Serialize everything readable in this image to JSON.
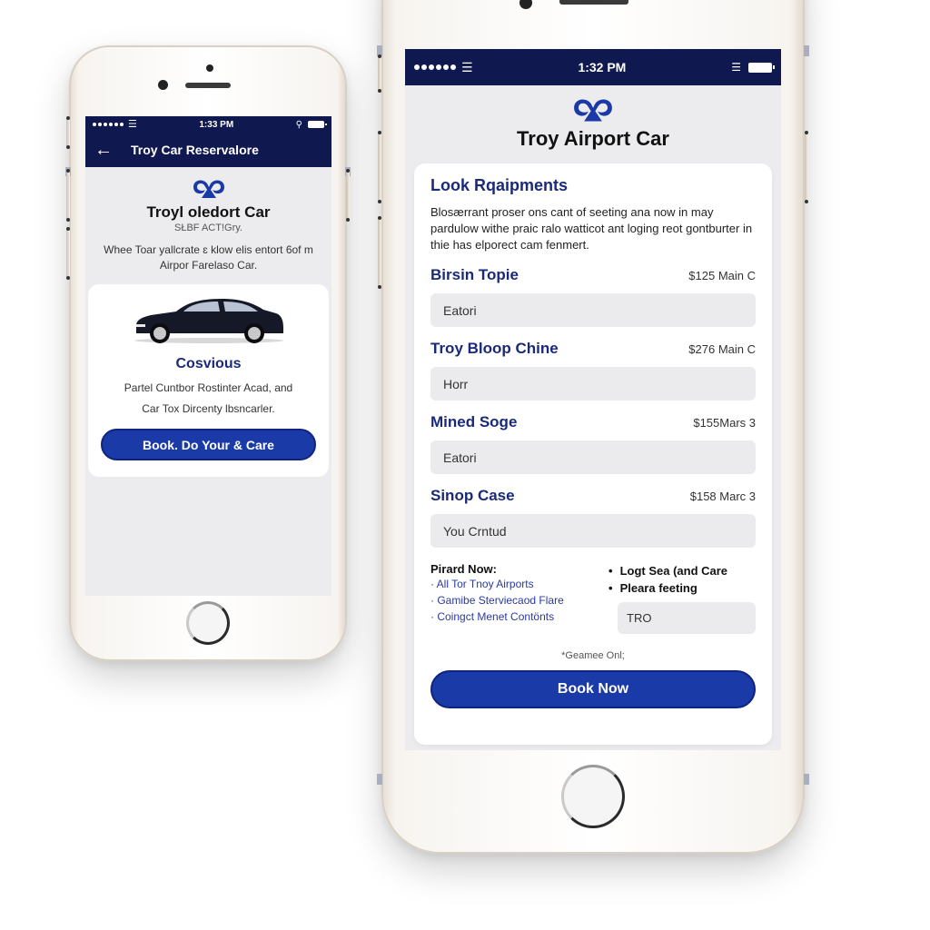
{
  "colors": {
    "navy": "#10194f",
    "brand_blue": "#1a3aa8",
    "heading_blue": "#1a2a7a",
    "screen_bg": "#ececee",
    "field_bg": "#ebebee"
  },
  "left_phone": {
    "status": {
      "time": "1:33 PM",
      "signal_icon": "signal-dots",
      "wifi_icon": "wifi-icon",
      "battery_icon": "battery-icon"
    },
    "navbar": {
      "back_icon": "←",
      "title": "Troy Car Reservalore"
    },
    "brand": {
      "logo_icon": "brand-logo",
      "title": "Troyl oledort Car",
      "subtitle": "SŁBF ACT!Gry.",
      "description": "Whee Toar yallcrate ɛ klow elis entort 6of m Airpor Farelaso Car."
    },
    "car_card": {
      "image": "black-sedan",
      "name": "Cosvious",
      "description_line1": "Partel Cuntbor Rostinter Acad, and",
      "description_line2": "Car Tox Dircenty lbsncarler.",
      "button_label": "Book. Do Your & Care"
    }
  },
  "right_phone": {
    "status": {
      "time": "1:32 PM",
      "signal_icon": "signal-dots",
      "wifi_icon": "wifi-icon",
      "battery_icon": "battery-icon"
    },
    "brand": {
      "logo_icon": "brand-logo",
      "title": "Troy Airport Car"
    },
    "card": {
      "heading": "Look Rqaipments",
      "intro": "Blosærrant proser ons cant of seeting ana now in may pardulow withe praic ralo watticot ant loging reot gontburter in thie has elporect cam fenmert.",
      "options": [
        {
          "name": "Birsin Topie",
          "price": "$125 Main C",
          "field_value": "Eatori"
        },
        {
          "name": "Troy Bloop Chine",
          "price": "$276 Main C",
          "field_value": "Horr"
        },
        {
          "name": "Mined Soge",
          "price": "$155Mars 3",
          "field_value": "Eatori"
        },
        {
          "name": "Sinop Case",
          "price": "$158 Marc 3",
          "field_value": "You Crntud"
        }
      ],
      "extras": {
        "label": "Pirard Now:",
        "links": [
          "All Tor Tnoy Airports",
          "Gamibe Sterviecaod Flare",
          "Coingct Menet Contönts"
        ],
        "bullets": [
          "Logt Sea (and Care",
          "Pleara feeting"
        ],
        "promo_value": "TRO"
      },
      "footnote": "*Geamee Onl;",
      "book_button": "Book Now"
    }
  }
}
